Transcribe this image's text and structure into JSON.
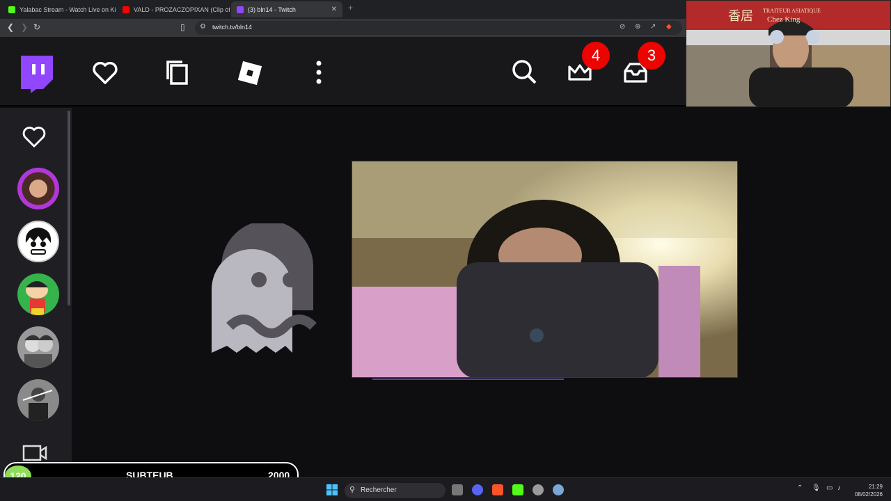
{
  "browser": {
    "tabs": [
      {
        "title": "Yalabac Stream - Watch Live on Kick",
        "favicon_color": "#53fc18"
      },
      {
        "title": "VALD - PROZACZOPIXAN (Clip offici",
        "favicon_color": "#ff0000"
      },
      {
        "title": "(3) bln14 - Twitch",
        "favicon_color": "#9146ff"
      }
    ],
    "new_tab": "+",
    "url": "twitch.tv/bln14"
  },
  "twitch": {
    "notifications_count": "4",
    "inbox_count": "3",
    "accent_color": "#9146ff"
  },
  "overlay": {
    "subgoal": {
      "current": "120",
      "label": "SUBTEUB",
      "target": "2000"
    }
  },
  "webcam_sign": {
    "shop_text": "TRAITEUR ASIATIQUE",
    "shop_name": "Chez King",
    "chinese": "香居"
  },
  "taskbar": {
    "search_placeholder": "Rechercher",
    "time": "21:29",
    "date": "08/02/2026"
  }
}
